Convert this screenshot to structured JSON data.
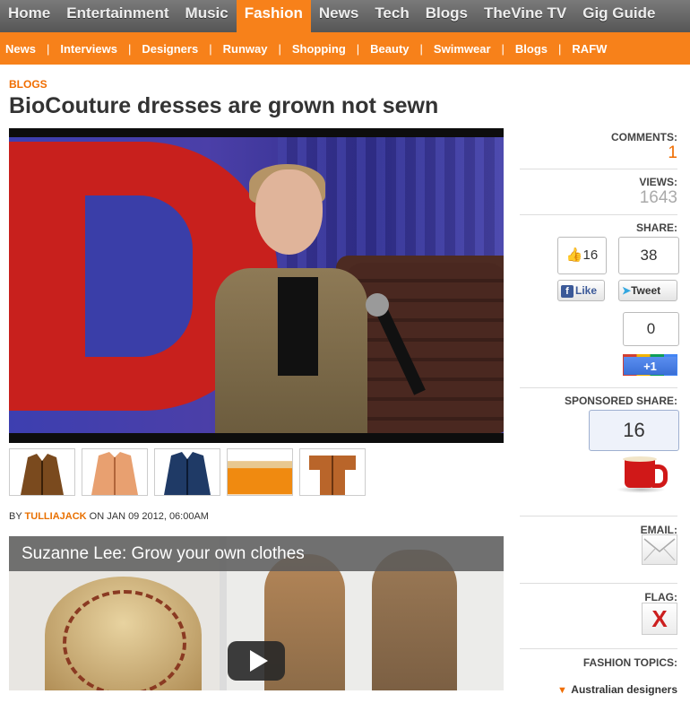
{
  "nav": {
    "items": [
      "Home",
      "Entertainment",
      "Music",
      "Fashion",
      "News",
      "Tech",
      "Blogs",
      "TheVine TV",
      "Gig Guide"
    ],
    "active": "Fashion"
  },
  "subnav": {
    "items": [
      "News",
      "Interviews",
      "Designers",
      "Runway",
      "Shopping",
      "Beauty",
      "Swimwear",
      "Blogs",
      "RAFW"
    ],
    "separator": "|"
  },
  "article": {
    "section": "BLOGS",
    "title": "BioCouture dresses are grown not sewn",
    "byline_prefix": "BY",
    "author": "TULLIAJACK",
    "date": "ON JAN 09 2012, 06:00AM"
  },
  "video_player": {
    "title": "Suzanne Lee: Grow your own clothes"
  },
  "sidebar": {
    "comments_label": "COMMENTS:",
    "comments_count": "1",
    "views_label": "VIEWS:",
    "views_count": "1643",
    "share_label": "SHARE:",
    "fb_count": "16",
    "fb_like_label": "Like",
    "tweet_count": "38",
    "tweet_label": "Tweet",
    "gplus_count": "0",
    "gplus_label": "+1",
    "sponsored_label": "SPONSORED SHARE:",
    "sponsored_count": "16",
    "email_label": "EMAIL:",
    "flag_label": "FLAG:",
    "flag_glyph": "X",
    "topics_label": "FASHION TOPICS:",
    "topic_1": "Australian designers"
  },
  "colors": {
    "accent": "#f7811a",
    "nav_bg": "#666666",
    "link": "#e97000"
  }
}
